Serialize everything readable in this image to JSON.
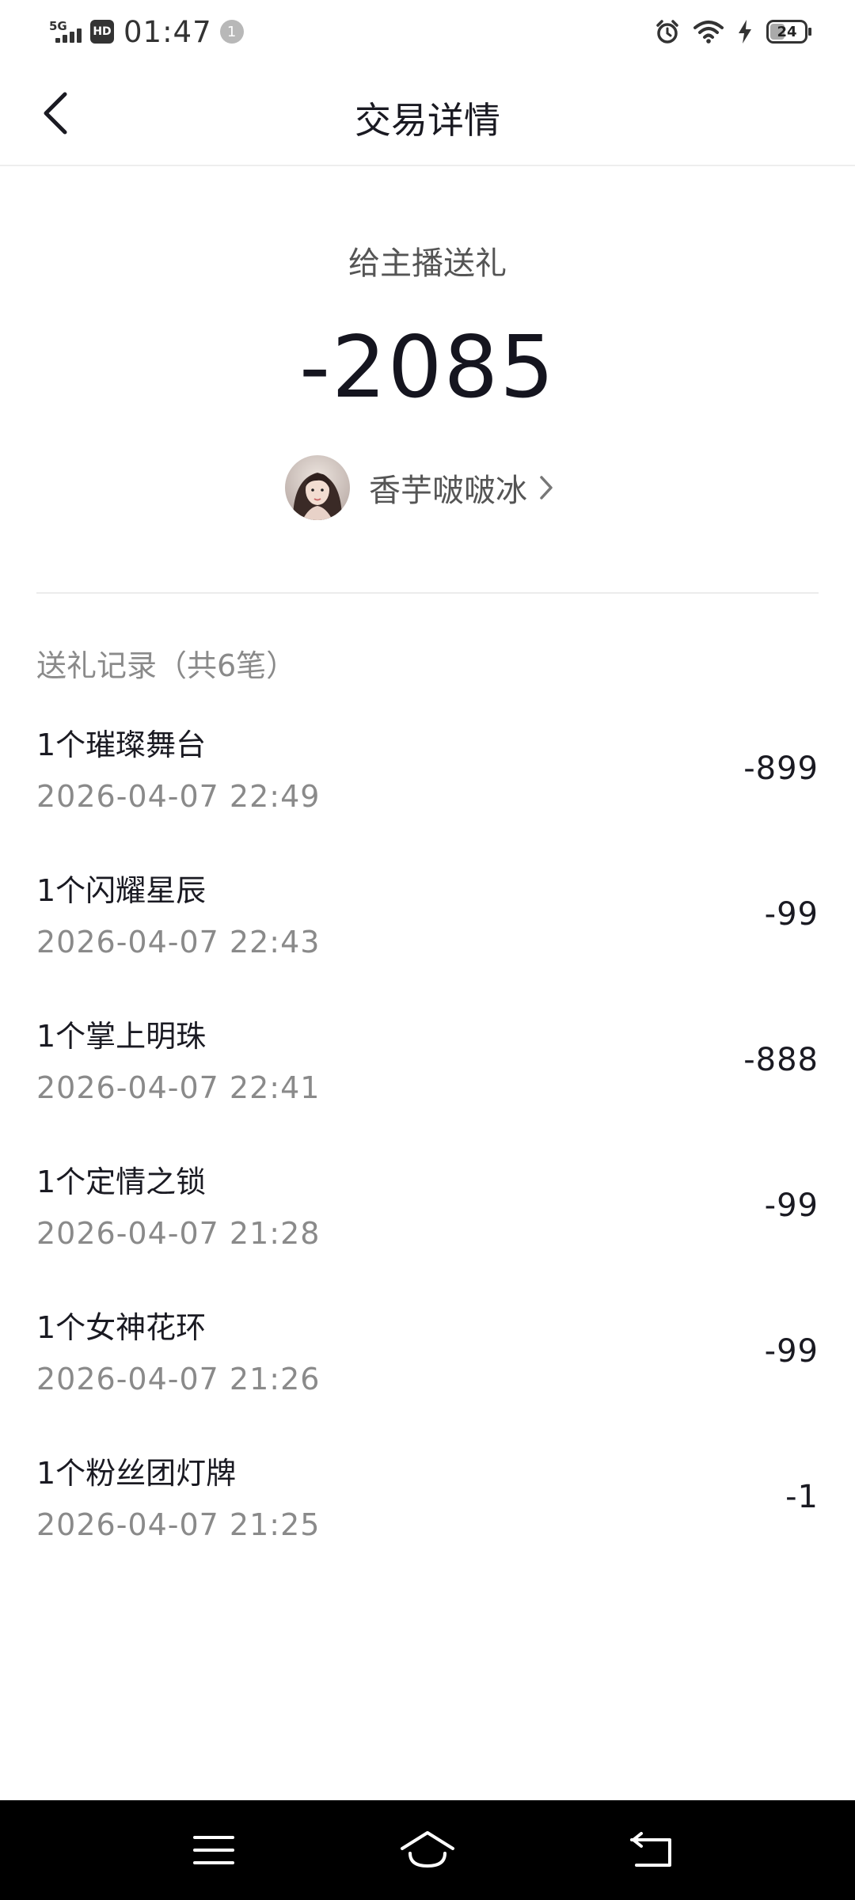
{
  "status_bar": {
    "network": "5G",
    "hd": "HD",
    "time": "01:47",
    "notification_count": "1",
    "battery": "24"
  },
  "header": {
    "title": "交易详情"
  },
  "summary": {
    "label": "给主播送礼",
    "amount": "-2085",
    "anchor_name": "香芋啵啵冰"
  },
  "records": {
    "title": "送礼记录（共6笔）",
    "items": [
      {
        "name": "1个璀璨舞台",
        "time": "2026-04-07 22:49",
        "amount": "-899"
      },
      {
        "name": "1个闪耀星辰",
        "time": "2026-04-07 22:43",
        "amount": "-99"
      },
      {
        "name": "1个掌上明珠",
        "time": "2026-04-07 22:41",
        "amount": "-888"
      },
      {
        "name": "1个定情之锁",
        "time": "2026-04-07 21:28",
        "amount": "-99"
      },
      {
        "name": "1个女神花环",
        "time": "2026-04-07 21:26",
        "amount": "-99"
      },
      {
        "name": "1个粉丝团灯牌",
        "time": "2026-04-07 21:25",
        "amount": "-1"
      }
    ]
  },
  "icons": {
    "back": "back-arrow-icon",
    "chevron": "chevron-right-icon",
    "menu": "menu-icon",
    "home": "home-icon",
    "return": "return-icon"
  },
  "colors": {
    "primary_text": "#1a1a22",
    "secondary_text": "#8a8a8a",
    "nav_bar": "#000000"
  }
}
